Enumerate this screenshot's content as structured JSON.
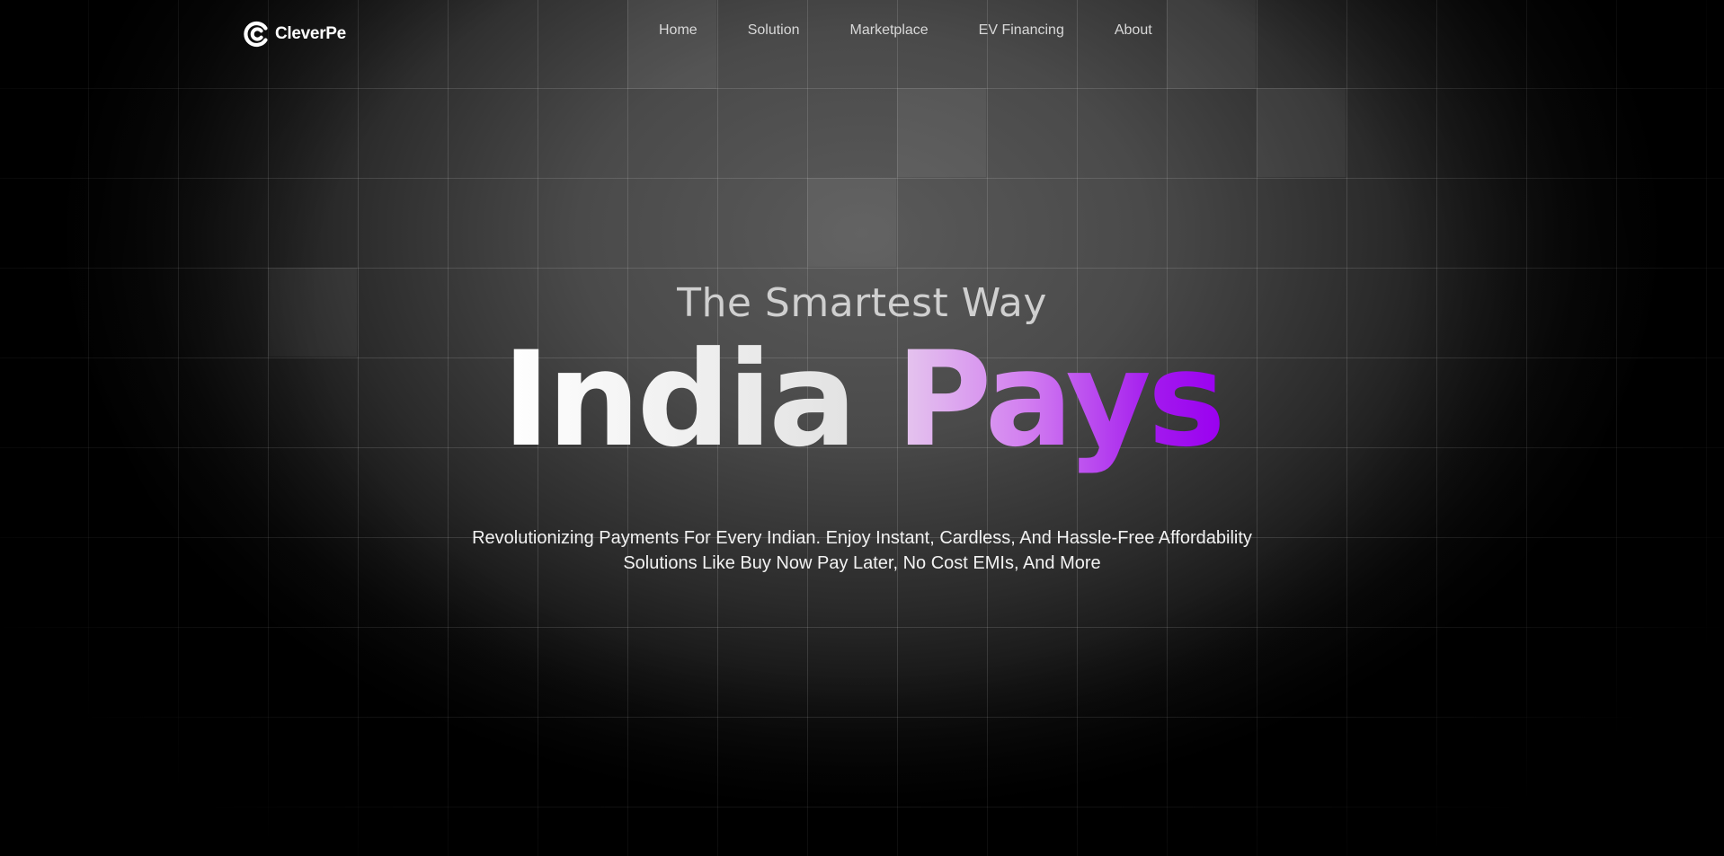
{
  "brand": {
    "name": "CleverPe",
    "logo_icon": "cleverpe-logo-icon"
  },
  "nav": {
    "items": [
      {
        "label": "Home"
      },
      {
        "label": "Solution"
      },
      {
        "label": "Marketplace"
      },
      {
        "label": "EV Financing"
      },
      {
        "label": "About"
      }
    ]
  },
  "hero": {
    "eyebrow": "The Smartest Way",
    "headline_part1": "India",
    "headline_part2": "Pays",
    "subtitle_line1": "Revolutionizing Payments For Every Indian. Enjoy Instant, Cardless, And Hassle-Free Affordability",
    "subtitle_line2": "Solutions Like Buy Now Pay Later, No Cost EMIs, And More"
  },
  "colors": {
    "background": "#000000",
    "accent_gradient_start": "#e6c9ee",
    "accent_gradient_end": "#9a00f0",
    "nav_text": "#d8d8d8"
  }
}
